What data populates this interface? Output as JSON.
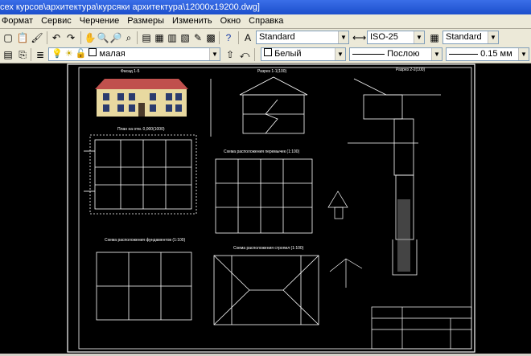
{
  "window": {
    "title": "сех курсов\\архитектура\\курсяки архитектура\\12000x19200.dwg]"
  },
  "menu": [
    "Формат",
    "Сервис",
    "Черчение",
    "Размеры",
    "Изменить",
    "Окно",
    "Справка"
  ],
  "toolbar1": {
    "text_style": "Standard",
    "dim_style": "ISO-25",
    "table_style": "Standard"
  },
  "toolbar2": {
    "layer": "малая",
    "color": "Белый",
    "linetype": "Послою",
    "lineweight": "0.15 мм"
  },
  "drawing": {
    "facade_label": "Фасад 1-5",
    "plan_label": "План на отм. 0,000(1000)",
    "section_label": "Разрез 1-1(100)",
    "section2_label": "Разрез 2-2(100)",
    "beams_label": "Схема расположения перемычек (1:100)",
    "foundation_label": "Схема расположения фундаментов (1:100)",
    "rafters_label": "Схема расположения стропил (1:100)"
  },
  "colors": {
    "roof": "#c0504d",
    "wall": "#e8d9a0",
    "window": "#2a3b6e",
    "lines": "#ffffff"
  }
}
